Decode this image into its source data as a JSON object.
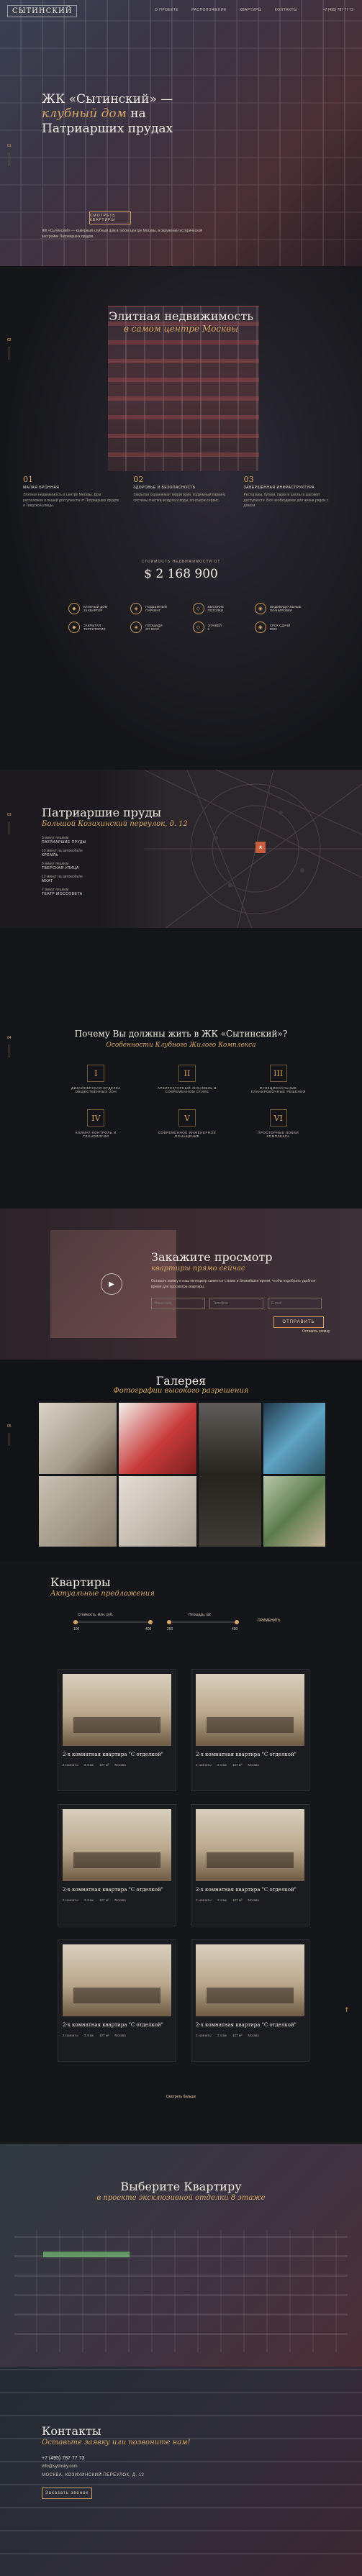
{
  "header": {
    "logo": "СЫТИНСКИЙ",
    "nav": [
      "О ПРОЕКТЕ",
      "РАСПОЛОЖЕНИЕ",
      "КВАРТИРЫ",
      "КОНТАКТЫ"
    ],
    "phone": "+7 (495) 787 77 73"
  },
  "hero": {
    "title_1": "ЖК «Сытинский» —",
    "title_2": "клубный дом",
    "title_3": "на",
    "title_4": "Патриарших прудах",
    "desc": "ЖК «Сытинский» — камерный клубный дом в тихом центре Москвы, в окружении исторической застройки Патриарших прудов.",
    "cta": "СМОТРЕТЬ КВАРТИРЫ"
  },
  "elite": {
    "title": "Элитная недвижимость",
    "subtitle": "в самом центре Москвы",
    "features": [
      {
        "num": "01",
        "title": "МАЛАЯ БРОННАЯ",
        "text": "Элитная недвижимость в центре Москвы. Дом расположен в пешей доступности от Патриарших прудов и Тверской улицы."
      },
      {
        "num": "02",
        "title": "ЗДОРОВЬЕ И БЕЗОПАСНОСТЬ",
        "text": "Закрытая охраняемая территория, подземный паркинг, системы очистки воздуха и воды, консьерж-сервис."
      },
      {
        "num": "03",
        "title": "ЗАВЕРШЁННАЯ ИНФРАСТРУКТУРА",
        "text": "Рестораны, бутики, парки и школы в шаговой доступности. Всё необходимое для жизни рядом с домом."
      }
    ],
    "price_label": "СТОИМОСТЬ НЕДВИЖИМОСТИ ОТ",
    "price": "$ 2 168 900",
    "stats": [
      {
        "icon": "◆",
        "a": "КЛУБНЫЙ ДОМ",
        "b": "25 КВАРТИР"
      },
      {
        "icon": "◈",
        "a": "ПОДЗЕМНЫЙ",
        "b": "ПАРКИНГ"
      },
      {
        "icon": "◇",
        "a": "ВЫСОКИЕ",
        "b": "ПОТОЛКИ"
      },
      {
        "icon": "◉",
        "a": "ИНДИВИДУАЛЬНЫЕ",
        "b": "ПЛАНИРОВКИ"
      },
      {
        "icon": "◆",
        "a": "ЗАКРЫТАЯ",
        "b": "ТЕРРИТОРИЯ"
      },
      {
        "icon": "◈",
        "a": "ПЛОЩАДИ",
        "b": "ОТ 69 М²"
      },
      {
        "icon": "◇",
        "a": "ЭТАЖЕЙ",
        "b": "6"
      },
      {
        "icon": "◉",
        "a": "СРОК СДАЧИ",
        "b": "2020"
      }
    ]
  },
  "location": {
    "title": "Патриаршие пруды",
    "address": "Большой Козихинский переулок, д. 12",
    "items": [
      {
        "a": "5 минут пешком",
        "b": "ПАТРИАРШИЕ ПРУДЫ"
      },
      {
        "a": "10 минут на автомобиле",
        "b": "КРЕМЛЬ"
      },
      {
        "a": "5 минут пешком",
        "b": "ТВЕРСКАЯ УЛИЦА"
      },
      {
        "a": "12 минут на автомобиле",
        "b": "МХАТ"
      },
      {
        "a": "7 минут пешком",
        "b": "ТЕАТР МОССОВЕТА"
      }
    ],
    "marker": "★"
  },
  "why": {
    "title": "Почему Вы должны жить в ЖК «Сытинский»?",
    "subtitle": "Особенности Клубного Жилого Комплекса",
    "items": [
      {
        "n": "I",
        "t": "ДИЗАЙНЕРСКАЯ ОТДЕЛКА ОБЩЕСТВЕННЫХ ЗОН"
      },
      {
        "n": "II",
        "t": "АРХИТЕКТУРНЫЙ АНСАМБЛЬ В СОВРЕМЕННОМ СТИЛЕ"
      },
      {
        "n": "III",
        "t": "ФУНКЦИОНАЛЬНЫЕ ПЛАНИРОВОЧНЫЕ РЕШЕНИЯ"
      },
      {
        "n": "IV",
        "t": "КЛИМАТ-КОНТРОЛЬ И ТЕХНОЛОГИИ"
      },
      {
        "n": "V",
        "t": "СОВРЕМЕННОЕ ИНЖЕНЕРНОЕ ОСНАЩЕНИЕ"
      },
      {
        "n": "VI",
        "t": "ПРОСТОРНЫЕ ЛОББИ КОМПЛЕКСА"
      }
    ]
  },
  "view": {
    "title": "Закажите просмотр",
    "subtitle": "квартиры прямо сейчас",
    "desc": "Оставьте заявку и наш менеджер свяжется с вами в ближайшее время, чтобы подобрать удобное время для просмотра квартиры.",
    "placeholders": [
      "Ваше имя",
      "Телефон",
      "E-mail"
    ],
    "submit": "ОТПРАВИТЬ",
    "side_btn": "Оставить заявку"
  },
  "gallery": {
    "title": "Галерея",
    "subtitle": "Фотографии высокого разрешения"
  },
  "apartments": {
    "title": "Квартиры",
    "subtitle": "Актуальные предложения",
    "filter1": "Стоимость, млн. руб.",
    "filter2": "Площадь, м2",
    "min1": "100",
    "max1": "400",
    "min2": "200",
    "max2": "400",
    "filter_btn": "ПРИМЕНИТЬ",
    "list": [
      {
        "title": "2-х комнатная квартира \"С отделкой\"",
        "s": "2 комнаты",
        "a": "3 этаж",
        "m": "107 м²",
        "p": "Москва"
      },
      {
        "title": "2-х комнатная квартира \"С отделкой\"",
        "s": "2 комнаты",
        "a": "3 этаж",
        "m": "107 м²",
        "p": "Москва"
      },
      {
        "title": "2-х комнатная квартира \"С отделкой\"",
        "s": "2 комнаты",
        "a": "3 этаж",
        "m": "107 м²",
        "p": "Москва"
      },
      {
        "title": "2-х комнатная квартира \"С отделкой\"",
        "s": "2 комнаты",
        "a": "3 этаж",
        "m": "107 м²",
        "p": "Москва"
      },
      {
        "title": "2-х комнатная квартира \"С отделкой\"",
        "s": "2 комнаты",
        "a": "3 этаж",
        "m": "107 м²",
        "p": "Москва"
      },
      {
        "title": "2-х комнатная квартира \"С отделкой\"",
        "s": "2 комнаты",
        "a": "3 этаж",
        "m": "107 м²",
        "p": "Москва"
      }
    ],
    "more": "Смотреть больше"
  },
  "choose": {
    "title": "Выберите Квартиру",
    "subtitle": "в проекте эксклюзивной отделки 8 этаже"
  },
  "contacts": {
    "title": "Контакты",
    "subtitle": "Оставьте заявку или позвоните нам!",
    "phone": "+7 (495) 787 77 73",
    "email": "info@sytinsky.com",
    "address": "МОСКВА, КОЗИХИНСКИЙ ПЕРЕУЛОК, Д. 12",
    "btn": "Заказать звонок"
  },
  "pager_labels": [
    "01",
    "02",
    "03",
    "04",
    "05"
  ]
}
